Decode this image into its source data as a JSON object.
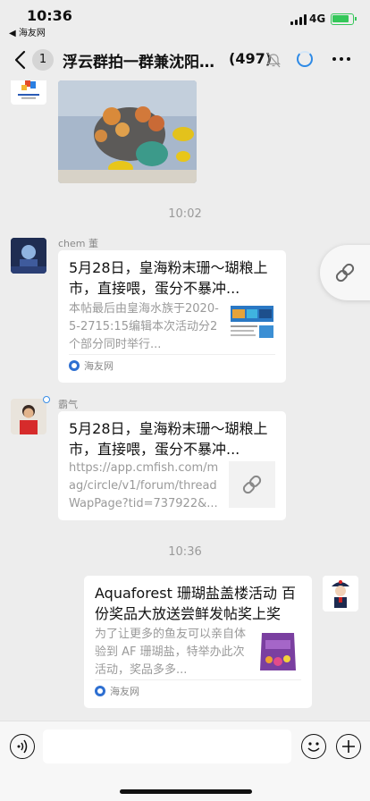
{
  "status_bar": {
    "time": "10:36",
    "back_app": "◀ 海友网",
    "network": "4G"
  },
  "nav": {
    "unread_badge": "1",
    "title": "浮云群拍一群兼沈阳…",
    "member_count": "(497)"
  },
  "messages": {
    "time_1": "10:02",
    "msg1": {
      "sender": "chem 董",
      "title": "5月28日，皇海粉末珊～瑚粮上市，直接喂，蛋分不暴冲...",
      "description": "本帖最后由皇海水族于2020-5-2715:15编辑本次活动分2个部分同时举行...",
      "source": "海友网"
    },
    "msg2": {
      "sender": "霸气",
      "title": "5月28日，皇海粉末珊～瑚粮上市，直接喂，蛋分不暴冲...",
      "description": "https://app.cmfish.com/mag/circle/v1/forum/threadWapPage?tid=737922&..."
    },
    "time_2": "10:36",
    "msg3": {
      "title": "Aquaforest 珊瑚盐盖楼活动 百份奖品大放送尝鲜发帖奖上奖",
      "description": "为了让更多的鱼友可以亲自体验到 AF 珊瑚盐，特举办此次活动，奖品多多...",
      "source": "海友网"
    }
  },
  "colors": {
    "background": "#ededed",
    "card": "#ffffff",
    "accent_blue": "#2e8ae6",
    "battery_green": "#34c759"
  }
}
